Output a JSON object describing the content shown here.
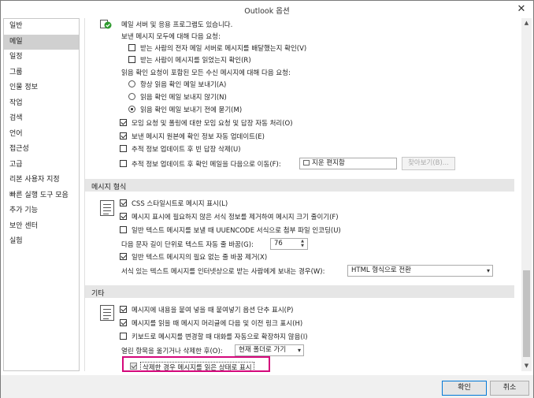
{
  "window": {
    "title": "Outlook 옵션",
    "close_glyph": "✕"
  },
  "sidebar": {
    "items": [
      {
        "label": "일반"
      },
      {
        "label": "메일"
      },
      {
        "label": "일정"
      },
      {
        "label": "그룹"
      },
      {
        "label": "인물 정보"
      },
      {
        "label": "작업"
      },
      {
        "label": "검색"
      },
      {
        "label": "언어"
      },
      {
        "label": "접근성"
      },
      {
        "label": "고급"
      },
      {
        "label": "리본 사용자 지정"
      },
      {
        "label": "빠른 실행 도구 모음"
      },
      {
        "label": "추가 기능"
      },
      {
        "label": "보안 센터"
      },
      {
        "label": "실험"
      }
    ],
    "selected": "메일"
  },
  "tracking": {
    "top_text": "메일 서버 및 응용 프로그램도 있습니다.",
    "send_request_label": "보낸 메시지 모두에 대해 다음 요청:",
    "delivery_receipt": {
      "label": "받는 사람의 전자 메일 서버로 메시지를 배달했는지 확인(V)",
      "checked": false
    },
    "read_receipt": {
      "label": "받는 사람이 메시지를 읽었는지 확인(R)",
      "checked": false
    },
    "incoming_label": "읽음 확인 요청이 포함된 모든 수신 메시지에 대해 다음 요청:",
    "radio_always": {
      "label": "항상 읽음 확인 메일 보내기(A)",
      "selected": false
    },
    "radio_never": {
      "label": "읽음 확인 메일 보내지 않기(N)",
      "selected": false
    },
    "radio_ask": {
      "label": "읽음 확인 메일 보내기 전에 묻기(M)",
      "selected": true
    },
    "auto_process": {
      "label": "모임 요청 및 폴링에 대한 모임 요청 및 답장 자동 처리(O)",
      "checked": true
    },
    "update_original": {
      "label": "보낸 메시지 원본에 확인 정보 자동 업데이트(E)",
      "checked": true
    },
    "delete_empty": {
      "label": "추적 정보 업데이트 후 빈 답장 삭제(U)",
      "checked": false
    },
    "move_receipts": {
      "label": "추적 정보 업데이트 후 확인 메일을 다음으로 이동(F):",
      "checked": false
    },
    "folder_value": "지운 편지함",
    "browse_label": "찾아보기(B)..."
  },
  "format": {
    "header": "메시지 형식",
    "css": {
      "label": "CSS 스타일시트로 메시지 표시(L)",
      "checked": true
    },
    "reduce": {
      "label": "메시지 표시에 필요하지 않은 서식 정보를 제거하여 메시지 크기 줄이기(F)",
      "checked": true
    },
    "uuencode": {
      "label": "일반 텍스트 메시지를 보낼 때 UUENCODE 서식으로 첨부 파일 인코딩(U)",
      "checked": false
    },
    "wrap_label": "다음 문자 길이 단위로 텍스트 자동 줄 바꿈(G):",
    "wrap_value": "76",
    "remove_breaks": {
      "label": "일반 텍스트 메시지의 필요 없는 줄 바꿈 제거(X)",
      "checked": true
    },
    "send_format_label": "서식 있는 텍스트 메시지를 인터넷상으로 받는 사람에게 보내는 경우(W):",
    "send_format_value": "HTML 형식으로 전환"
  },
  "other": {
    "header": "기타",
    "paste_options": {
      "label": "메시지에 내용을 붙여 넣을 때 붙여넣기 옵션 단추 표시(P)",
      "checked": true
    },
    "prev_next": {
      "label": "메시지를 읽을 때 메시지 머리글에 다음 및 이전 링크 표시(H)",
      "checked": true
    },
    "expand_conv": {
      "label": "키보드로 메시지를 변경할 때 대화를 자동으로 확장하지 않음(I)",
      "checked": false
    },
    "after_move_label": "열린 항목을 옮기거나 삭제한 후(O):",
    "after_move_value": "현재 폴더로 가기",
    "mark_read": {
      "label": "삭제한 경우 메시지를 읽은 상태로 표시",
      "checked": true
    }
  },
  "footer": {
    "ok": "확인",
    "cancel": "취소"
  },
  "colors": {
    "highlight": "#d4087b",
    "ok_border": "#0078d7",
    "section_header": "#e6e6e6",
    "nav_selected": "#d0d0d0"
  }
}
